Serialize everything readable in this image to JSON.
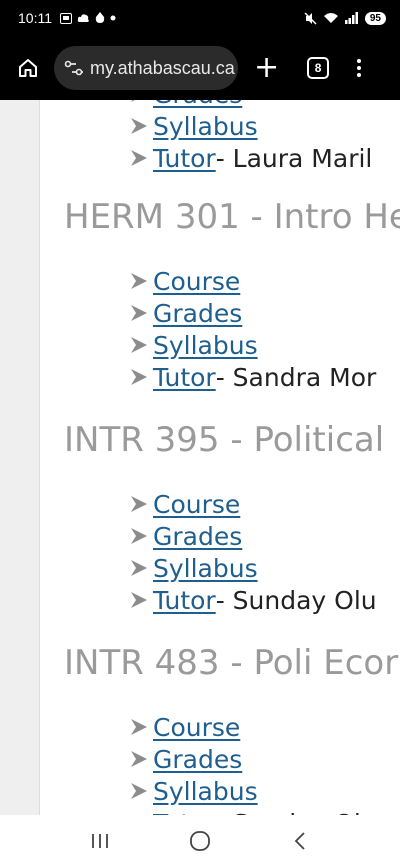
{
  "status_bar": {
    "time": "10:11",
    "battery": "95"
  },
  "browser": {
    "url": "my.athabascau.ca",
    "tab_count": "8"
  },
  "page": {
    "top_partial_links": [
      {
        "label": "Grades",
        "suffix": ""
      },
      {
        "label": "Syllabus",
        "suffix": ""
      },
      {
        "label": "Tutor",
        "suffix": " - Laura Maril"
      }
    ],
    "courses": [
      {
        "title": "HERM 301 - Intro He",
        "links": [
          {
            "label": "Course",
            "suffix": ""
          },
          {
            "label": "Grades",
            "suffix": ""
          },
          {
            "label": "Syllabus",
            "suffix": ""
          },
          {
            "label": "Tutor",
            "suffix": " - Sandra Mor"
          }
        ]
      },
      {
        "title": "INTR 395 - Political",
        "links": [
          {
            "label": "Course",
            "suffix": ""
          },
          {
            "label": "Grades",
            "suffix": ""
          },
          {
            "label": "Syllabus",
            "suffix": ""
          },
          {
            "label": "Tutor",
            "suffix": " - Sunday Olu"
          }
        ]
      },
      {
        "title": "INTR 483 - Poli Ecor",
        "links": [
          {
            "label": "Course",
            "suffix": ""
          },
          {
            "label": "Grades",
            "suffix": ""
          },
          {
            "label": "Syllabus",
            "suffix": ""
          },
          {
            "label": "Tutor",
            "suffix": " - Sunday Olu"
          }
        ]
      }
    ]
  },
  "colors": {
    "link": "#1f5f8f",
    "title": "#9a9a9a",
    "bullet": "#8c8c8c"
  },
  "icons": {
    "home": "home-icon",
    "site_settings": "site-settings-icon",
    "new_tab": "plus-icon",
    "tabs": "tab-switcher-icon",
    "menu": "more-vert-icon",
    "nav_recents": "recents-icon",
    "nav_home": "nav-home-icon",
    "nav_back": "back-icon"
  }
}
